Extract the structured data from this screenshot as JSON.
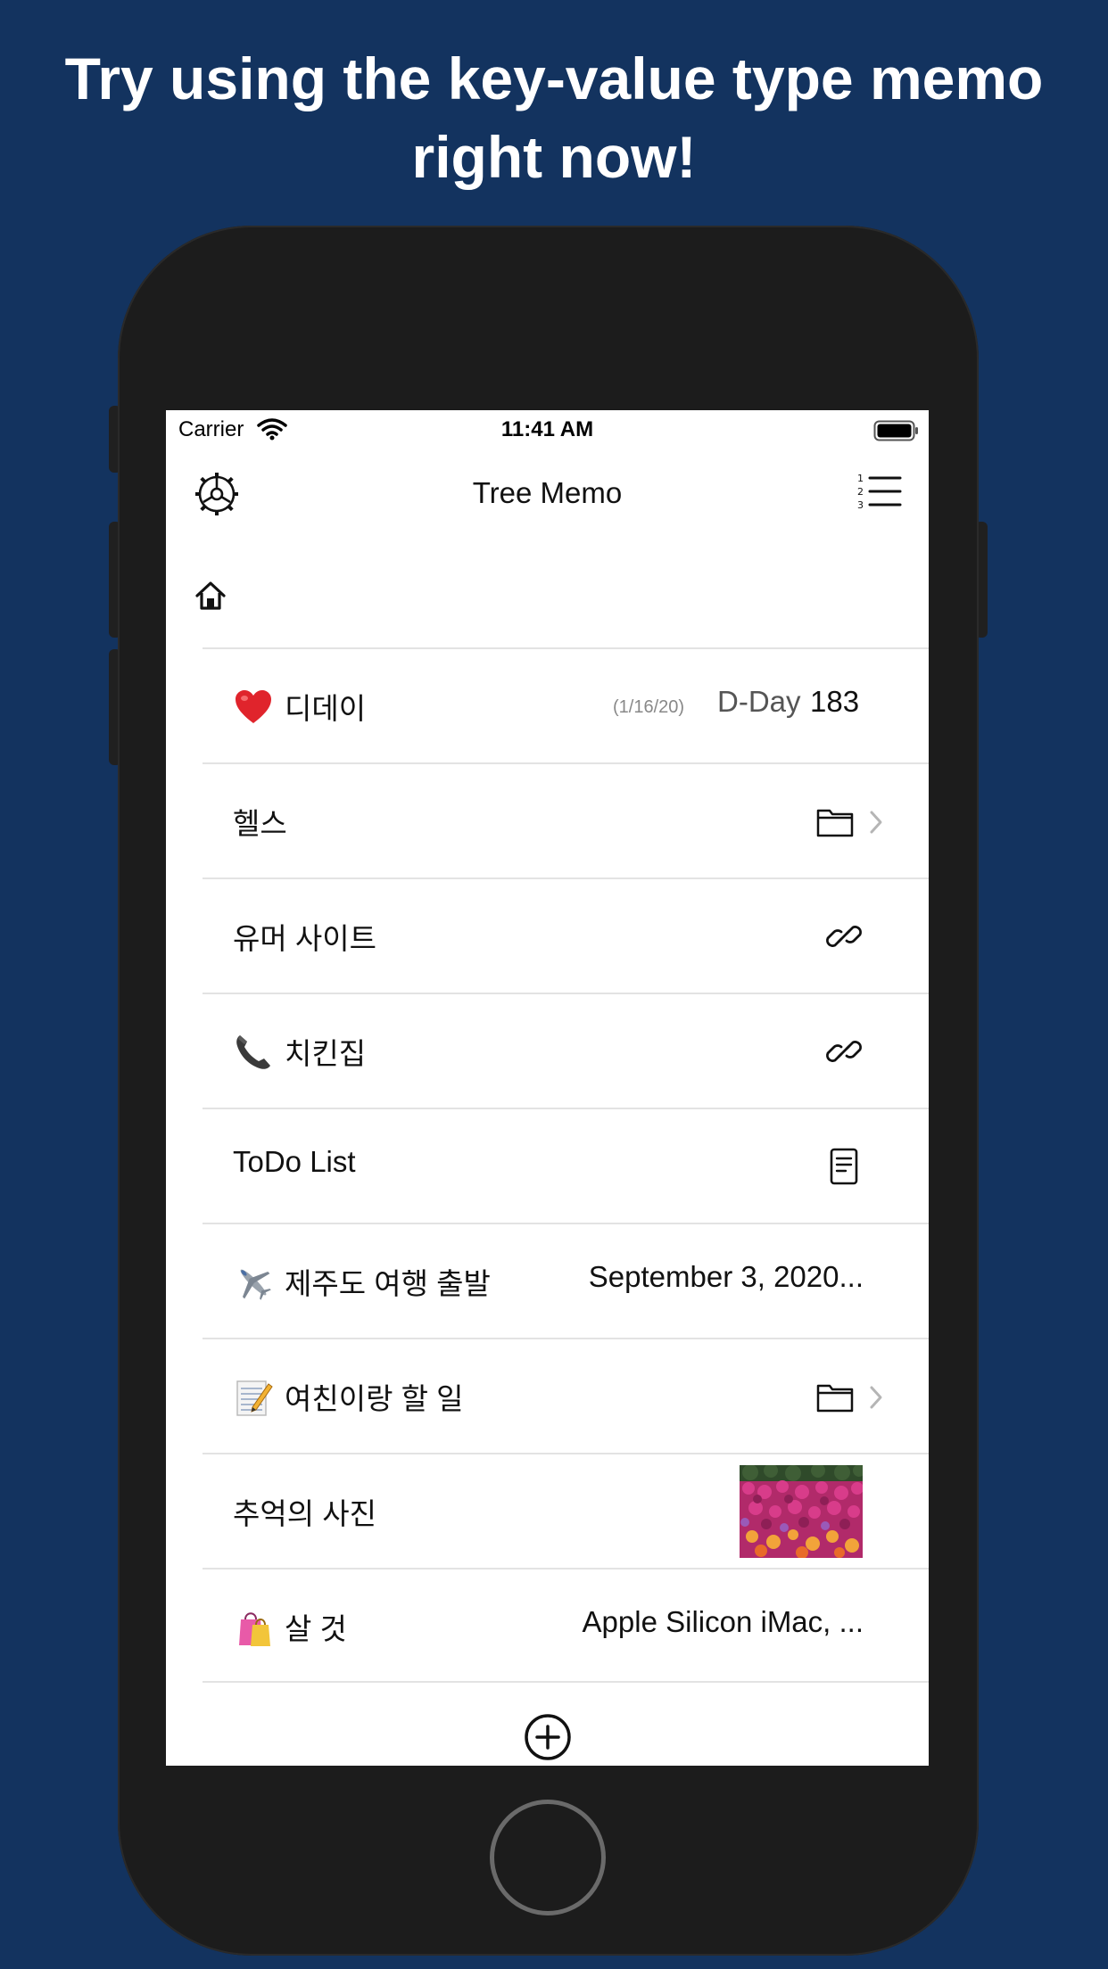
{
  "headline": "Try using the key-value type memo right now!",
  "status_bar": {
    "carrier": "Carrier",
    "time": "11:41 AM"
  },
  "navbar": {
    "title": "Tree Memo"
  },
  "rows": [
    {
      "emoji": "heart",
      "title": "디데이",
      "date": "(1/16/20)",
      "label": "D-Day",
      "count": "183"
    },
    {
      "title": "헬스",
      "icon": "folder-icon"
    },
    {
      "title": "유머 사이트",
      "icon": "link-icon"
    },
    {
      "emoji": "phone",
      "title": "치킨집",
      "icon": "link-icon"
    },
    {
      "title": "ToDo List",
      "icon": "document-icon"
    },
    {
      "emoji": "airplane",
      "title": "제주도 여행 출발",
      "value": "September 3, 2020..."
    },
    {
      "emoji": "memo",
      "title": "여친이랑 할 일",
      "icon": "folder-icon"
    },
    {
      "title": "추억의 사진",
      "icon": "photo-thumbnail"
    },
    {
      "emoji": "shopping-bags",
      "title": "살 것",
      "value": "Apple Silicon iMac, ..."
    }
  ],
  "colors": {
    "background": "#13335f",
    "phone": "#1c1c1c",
    "separator": "#e3e3e3"
  }
}
